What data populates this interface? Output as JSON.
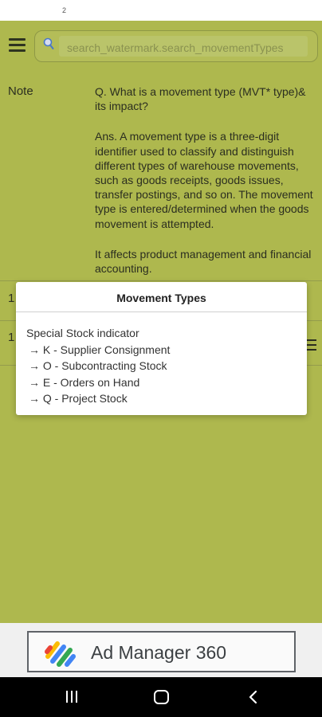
{
  "status_bar": {
    "text": "2"
  },
  "search": {
    "placeholder": "search_watermark.search_movementTypes"
  },
  "note": {
    "label": "Note",
    "paragraphs": [
      "Q. What is a movement type (MVT* type)& its impact?",
      "Ans. A movement type is a three-digit identifier used to classify and distinguish different types of warehouse movements, such as goods receipts, goods issues, transfer postings, and so on. The movement type is entered/determined when the goods movement is attempted.",
      "It affects product management and financial accounting."
    ]
  },
  "rows": [
    {
      "number": "1"
    },
    {
      "number": "1"
    }
  ],
  "dialog": {
    "title": "Movement Types",
    "heading": "Special Stock indicator",
    "items": [
      "→ K - Supplier Consignment",
      "→ O - Subcontracting Stock",
      "→ E - Orders on Hand",
      "→ Q - Project Stock"
    ]
  },
  "ad": {
    "text": "Ad Manager 360"
  },
  "colors": {
    "app_background": "#aeb84e",
    "dialog_background": "#ffffff",
    "nav_bar": "#000000"
  },
  "icons": {
    "menu": "hamburger-menu-icon",
    "search": "search-icon",
    "ad_logo": "ad-manager-logo",
    "nav_recent": "recent-apps-icon",
    "nav_home": "home-icon",
    "nav_back": "back-icon"
  }
}
